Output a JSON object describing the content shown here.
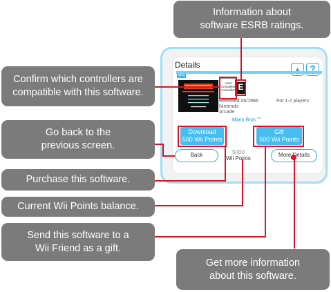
{
  "callouts": {
    "esrb": "Information about\nsoftware ESRB ratings.",
    "controllers": "Confirm which controllers are\ncompatible with this software.",
    "back": "Go back to the\nprevious screen.",
    "purchase": "Purchase this software.",
    "balance": "Current Wii Points balance.",
    "gift": "Send this software to a\nWii Friend as a gift.",
    "more": "Get more information\nabout this software."
  },
  "screen": {
    "title": "Details",
    "console_tag": "NES",
    "view_controllers": "View\ncompatible\ncontrollers",
    "esrb_letter": "E",
    "released": "Released 06/1986",
    "publisher": "Nintendo",
    "genre": "Arcade",
    "players": "For 1-2 players",
    "game_title": "Mario Bros.",
    "game_trademark": "TM",
    "download_label": "Download",
    "download_price": "500 Wii Points",
    "gift_label": "Gift",
    "gift_price": "500 Wii Points",
    "back_label": "Back",
    "balance_value": "5000",
    "balance_unit": "Wii Points",
    "more_details_label": "More Details",
    "scroll_up_symbol": "▲",
    "help_symbol": "?"
  },
  "colors": {
    "callout_bg": "#7b7b7b",
    "leader_line": "#e01020",
    "wii_blue": "#45bdf0",
    "frame_blue": "#9edff7"
  }
}
